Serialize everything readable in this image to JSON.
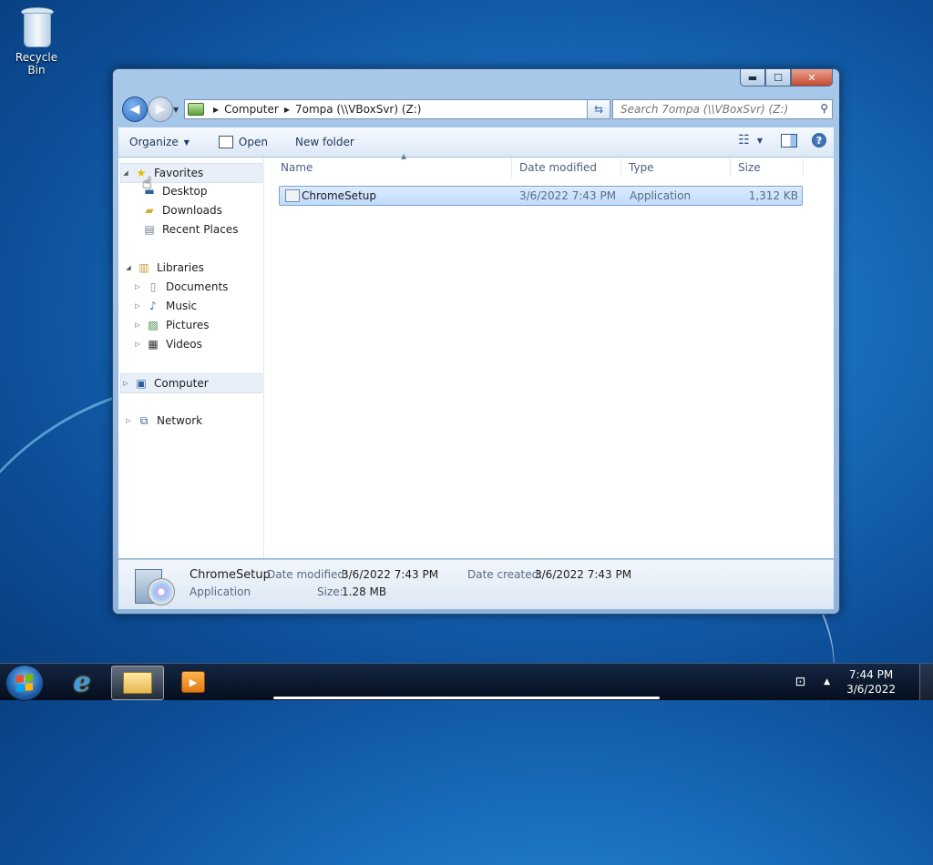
{
  "desktop": {
    "recycle_bin_label": "Recycle Bin"
  },
  "window": {
    "controls": {
      "minimize": "▬",
      "maximize": "☐",
      "close": "✕"
    },
    "address": {
      "crumbs": [
        "Computer",
        "7ompa (\\\\VBoxSvr) (Z:)"
      ]
    },
    "search_placeholder": "Search 7ompa (\\\\VBoxSvr) (Z:)",
    "toolbar": {
      "organize": "Organize",
      "open": "Open",
      "new_folder": "New folder"
    },
    "nav": {
      "favorites": "Favorites",
      "desktop": "Desktop",
      "downloads": "Downloads",
      "recent_places": "Recent Places",
      "libraries": "Libraries",
      "documents": "Documents",
      "music": "Music",
      "pictures": "Pictures",
      "videos": "Videos",
      "computer": "Computer",
      "network": "Network"
    },
    "columns": {
      "name": "Name",
      "date_modified": "Date modified",
      "type": "Type",
      "size": "Size"
    },
    "files": [
      {
        "name": "ChromeSetup",
        "date_modified": "3/6/2022 7:43 PM",
        "type": "Application",
        "size": "1,312 KB"
      }
    ],
    "details": {
      "name": "ChromeSetup",
      "type": "Application",
      "date_modified_label": "Date modified:",
      "date_modified": "3/6/2022 7:43 PM",
      "date_created_label": "Date created:",
      "date_created": "3/6/2022 7:43 PM",
      "size_label": "Size:",
      "size": "1.28 MB"
    }
  },
  "taskbar": {
    "time": "7:44 PM",
    "date": "3/6/2022"
  }
}
